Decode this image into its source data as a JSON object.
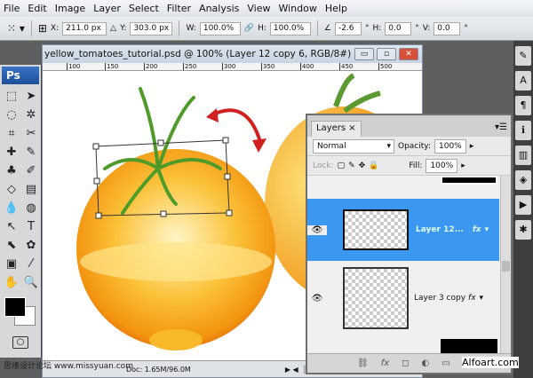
{
  "menu": [
    "File",
    "Edit",
    "Image",
    "Layer",
    "Select",
    "Filter",
    "Analysis",
    "View",
    "Window",
    "Help"
  ],
  "options": {
    "x": "211.0 px",
    "y": "303.0 px",
    "w": "100.0%",
    "h": "100.0%",
    "angle": "-2.6",
    "hskew": "0.0",
    "vskew": "0.0",
    "x_label": "X:",
    "y_label": "Y:",
    "w_label": "W:",
    "h_label": "H:",
    "hs_label": "H:",
    "vs_label": "V:",
    "deg": "°"
  },
  "toolbox": {
    "logo": "Ps"
  },
  "document": {
    "title": "yellow_tomatoes_tutorial.psd @ 100% (Layer 12 copy 6, RGB/8#)",
    "ruler": [
      "100",
      "150",
      "200",
      "250",
      "300",
      "350",
      "400",
      "450",
      "500"
    ],
    "status": "Doc: 1.65M/96.0M"
  },
  "layers": {
    "tab": "Layers",
    "blend": "Normal",
    "opacity_label": "Opacity:",
    "opacity": "100%",
    "lock_label": "Lock:",
    "fill_label": "Fill:",
    "fill": "100%",
    "items": [
      {
        "name": "Layer 12...",
        "fx": "fx",
        "selected": true
      },
      {
        "name": "Layer 3 copy",
        "fx": "fx",
        "selected": false
      }
    ]
  },
  "colors": {
    "selection": "#3c97f0",
    "arrow": "#d02020"
  },
  "watermarks": {
    "left": "思缘设计论坛 www.missyuan.com",
    "right": "Alfoart.com"
  }
}
